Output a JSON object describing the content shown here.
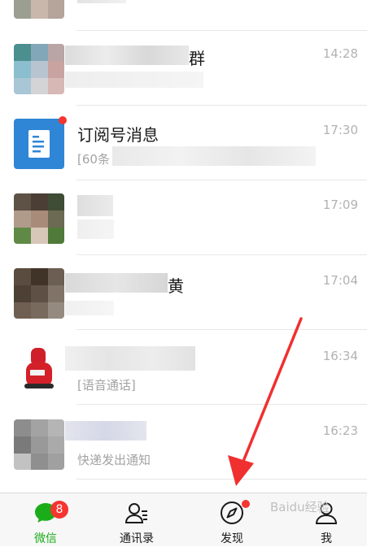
{
  "colors": {
    "accent": "#1aad19",
    "badge": "#f43530",
    "arrow": "#f0302f",
    "subscription_icon": "#2f86d6"
  },
  "chats": [
    {
      "name": "",
      "time": "",
      "preview": ""
    },
    {
      "name": "群",
      "time": "14:28",
      "preview": ""
    },
    {
      "name": "订阅号消息",
      "time": "17:30",
      "preview": "[60条",
      "avatar_icon": "document-icon",
      "unread_dot": true
    },
    {
      "name": "",
      "time": "17:09",
      "preview": ""
    },
    {
      "name": "黄",
      "time": "17:04",
      "preview": ""
    },
    {
      "name": "",
      "time": "16:34",
      "preview": "[语音通话]"
    },
    {
      "name": "",
      "time": "16:23",
      "preview": "快递发出通知"
    }
  ],
  "tabbar": {
    "tabs": [
      {
        "label": "微信",
        "icon": "chat-bubble-icon",
        "active": true,
        "badge": "8"
      },
      {
        "label": "通讯录",
        "icon": "contacts-icon"
      },
      {
        "label": "发现",
        "icon": "compass-icon",
        "unread_dot": true
      },
      {
        "label": "我",
        "icon": "person-icon"
      }
    ]
  },
  "watermark": "Baidu经验"
}
